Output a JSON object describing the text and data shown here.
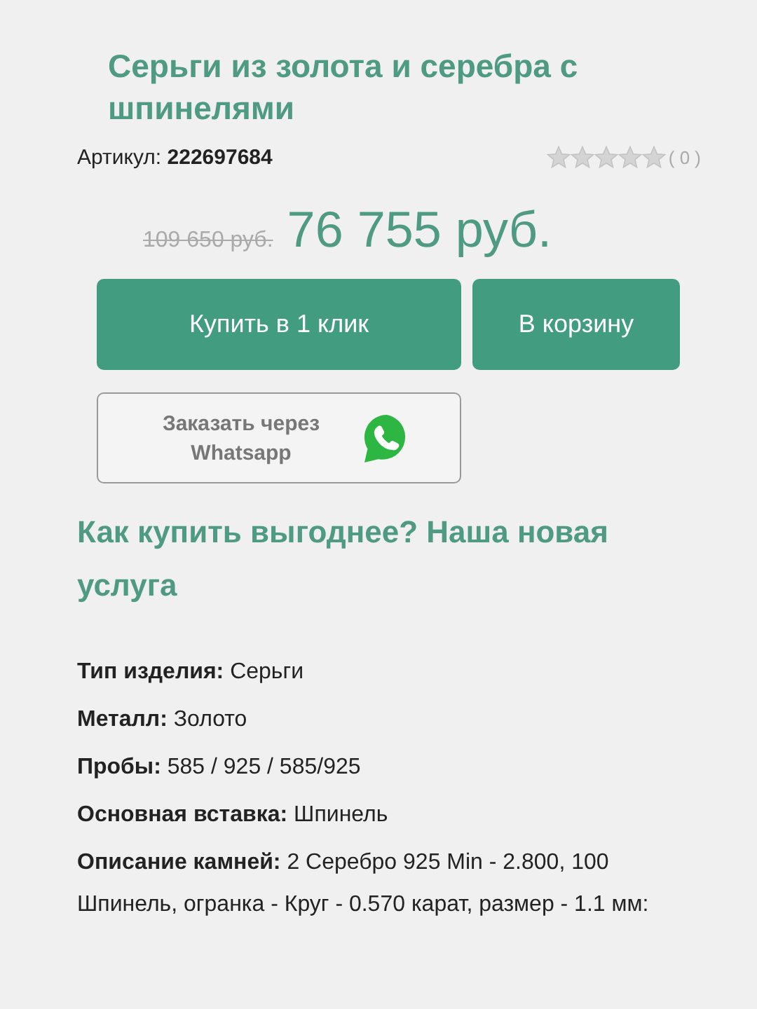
{
  "product": {
    "title": "Серьги из золота и серебра с шпинелями",
    "article_label": "Артикул:",
    "article": "222697684",
    "stars": 0,
    "reviews": "( 0 )",
    "old_price": "109 650 руб.",
    "price": "76 755 руб."
  },
  "buttons": {
    "buy_one_click": "Купить в 1 клик",
    "cart": "В корзину",
    "whatsapp": "Заказать через Whatsapp"
  },
  "promo_heading": "Как купить выгоднее? Наша новая услуга",
  "specs": [
    "**Тип изделия:** Серьги",
    "**Металл:** Золото",
    "**Пробы:** 585 / 925 / 585/925",
    "**Основная вставка:** Шпинель",
    "**Описание камней:** 2 Серебро 925 Min - 2.800, 100 Шпинель, огранка - Круг - 0.570 карат, размер - 1.1 мм:"
  ]
}
